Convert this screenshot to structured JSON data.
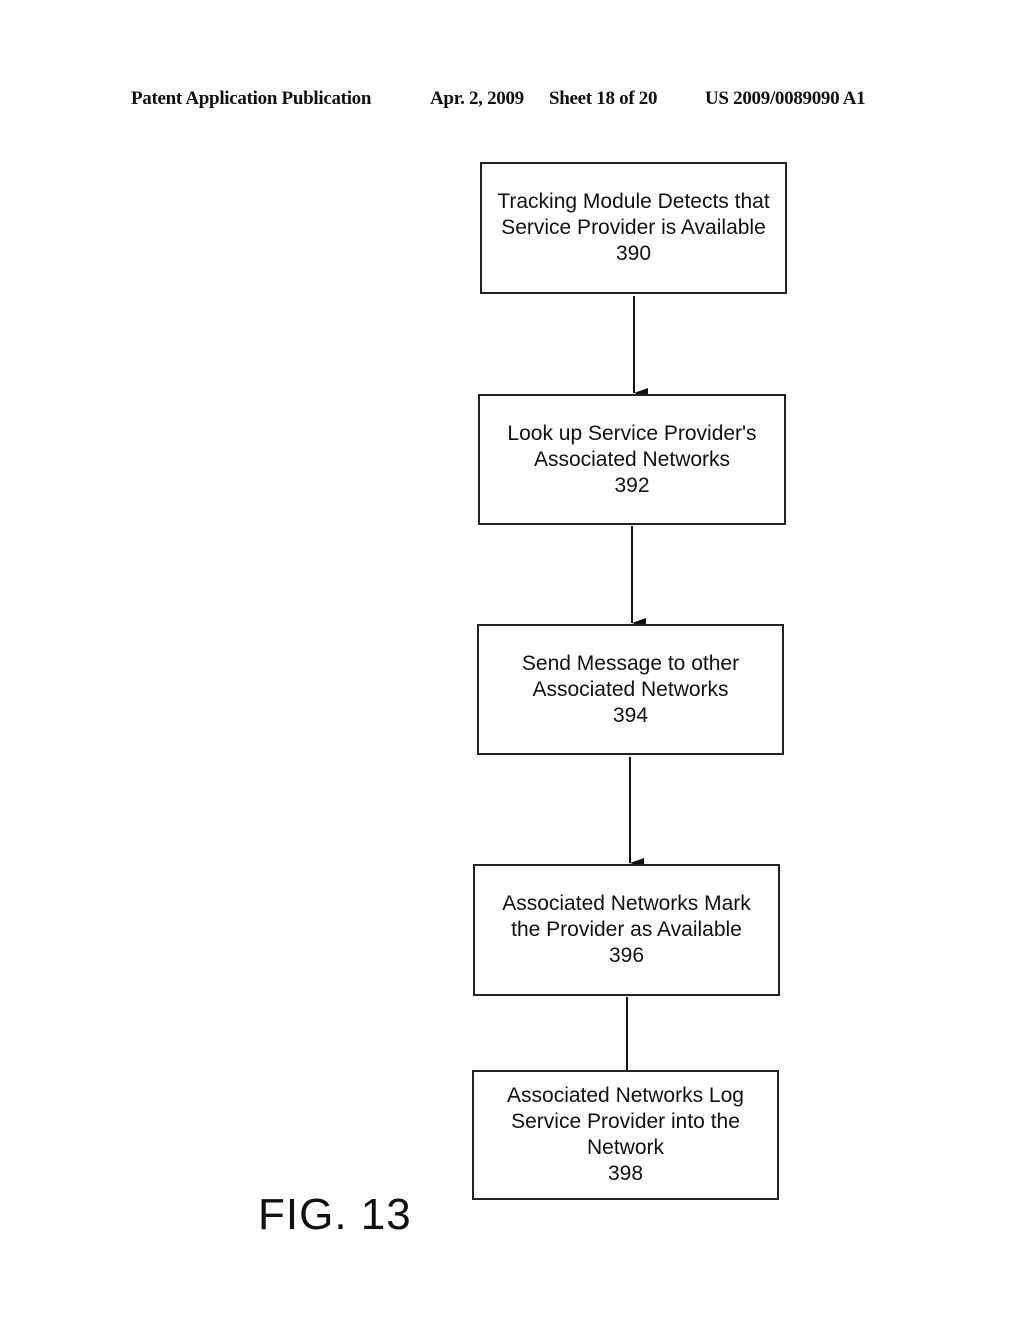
{
  "header": {
    "publication": "Patent Application Publication",
    "date": "Apr. 2, 2009",
    "sheet": "Sheet 18 of 20",
    "number": "US 2009/0089090 A1"
  },
  "figure_label": "FIG. 13",
  "steps": [
    {
      "lines": [
        "Tracking Module Detects that",
        "Service Provider is Available"
      ],
      "ref": "390"
    },
    {
      "lines": [
        "Look up Service Provider's",
        "Associated Networks"
      ],
      "ref": "392"
    },
    {
      "lines": [
        "Send Message to other",
        "Associated Networks"
      ],
      "ref": "394"
    },
    {
      "lines": [
        "Associated Networks Mark",
        "the Provider as Available"
      ],
      "ref": "396"
    },
    {
      "lines": [
        "Associated Networks Log",
        "Service Provider into the",
        "Network"
      ],
      "ref": "398"
    }
  ]
}
